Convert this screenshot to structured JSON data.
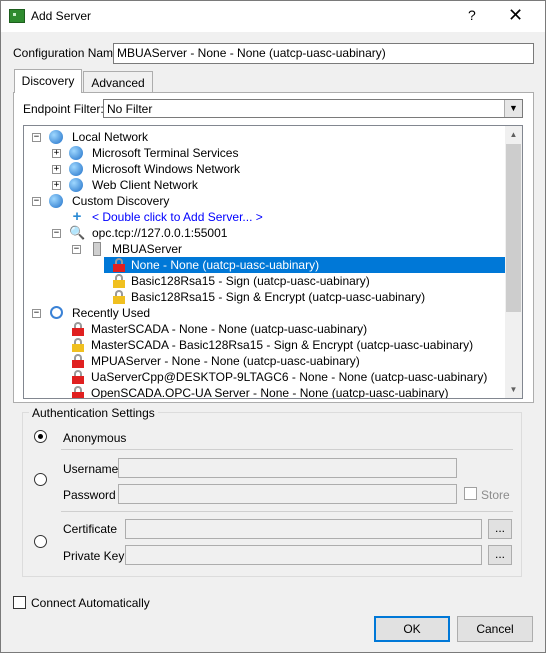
{
  "window": {
    "title": "Add Server",
    "help_glyph": "?",
    "close_glyph": "✕"
  },
  "config": {
    "label": "Configuration Name",
    "value": "MBUAServer - None - None (uatcp-uasc-uabinary)"
  },
  "tabs": [
    {
      "label": "Discovery"
    },
    {
      "label": "Advanced"
    }
  ],
  "filter": {
    "label": "Endpoint Filter:",
    "value": "No Filter",
    "arrow": "▼"
  },
  "scroll": {
    "up": "▲",
    "down": "▼"
  },
  "tree": {
    "local_network": "Local Network",
    "local_children": [
      "Microsoft Terminal Services",
      "Microsoft Windows Network",
      "Web Client Network"
    ],
    "custom_discovery": "Custom Discovery",
    "add_server": "< Double click to Add Server... >",
    "opc_url": "opc.tcp://127.0.0.1:55001",
    "server_name": "MBUAServer",
    "endpoints": [
      "None - None (uatcp-uasc-uabinary)",
      "Basic128Rsa15 - Sign (uatcp-uasc-uabinary)",
      "Basic128Rsa15 - Sign & Encrypt (uatcp-uasc-uabinary)"
    ],
    "recently_used": "Recently Used",
    "recent": [
      "MasterSCADA - None - None (uatcp-uasc-uabinary)",
      "MasterSCADA - Basic128Rsa15 - Sign & Encrypt (uatcp-uasc-uabinary)",
      "MPUAServer - None - None (uatcp-uasc-uabinary)",
      "UaServerCpp@DESKTOP-9LTAGC6 - None - None (uatcp-uasc-uabinary)",
      "OpenSCADA.OPC-UA Server - None - None (uatcp-uasc-uabinary)"
    ],
    "expand_minus": "−",
    "expand_plus": "+"
  },
  "auth": {
    "title": "Authentication Settings",
    "anonymous": "Anonymous",
    "username": "Username",
    "password": "Password",
    "store": "Store",
    "certificate": "Certificate",
    "private_key": "Private Key",
    "browse": "..."
  },
  "connect_auto": "Connect Automatically",
  "buttons": {
    "ok": "OK",
    "cancel": "Cancel"
  }
}
